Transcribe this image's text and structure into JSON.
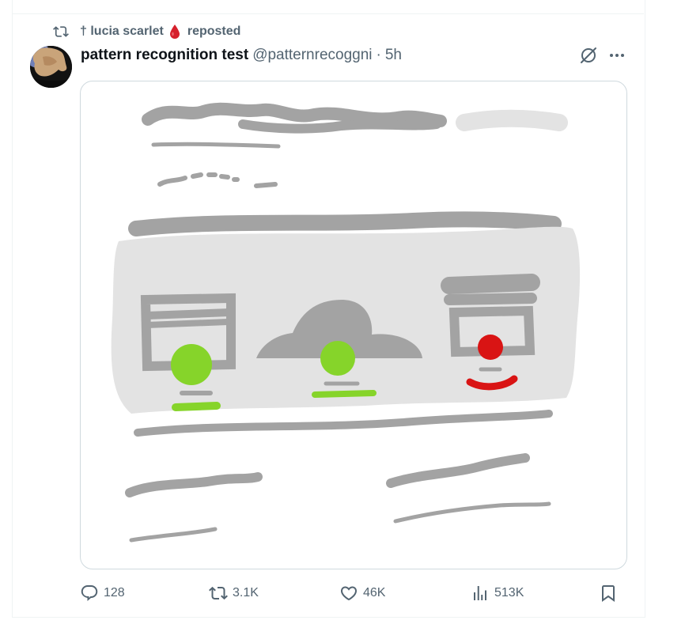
{
  "social_context": {
    "user": "† lucia scarlet",
    "action": "reposted"
  },
  "tweet": {
    "display_name": "pattern recognition test",
    "handle": "@patternrecoggni",
    "separator": "·",
    "time": "5h"
  },
  "metrics": {
    "replies": "128",
    "reposts": "3.1K",
    "likes": "46K",
    "views": "513K"
  },
  "icons": {
    "repost": "repost-icon",
    "blood": "blood-drop-icon",
    "grok": "grok-icon",
    "more": "more-icon",
    "reply": "reply-icon",
    "like": "heart-icon",
    "views": "views-chart-icon",
    "bookmark": "bookmark-icon"
  },
  "colors": {
    "muted": "#536471",
    "text": "#0f1419",
    "drawing_gray": "#a3a3a3",
    "drawing_light": "#e3e3e3",
    "green": "#86d42a",
    "red": "#d91414"
  }
}
